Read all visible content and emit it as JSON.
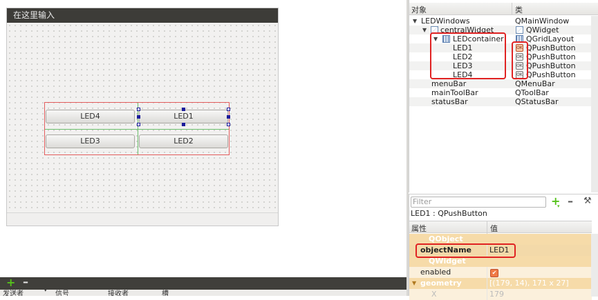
{
  "form": {
    "title_bar_text": "在这里输入",
    "buttons": {
      "led1": "LED1",
      "led2": "LED2",
      "led3": "LED3",
      "led4": "LED4"
    }
  },
  "signal_slot_panel": {
    "add_icon": "plus-icon",
    "remove_icon": "minus-icon",
    "columns": [
      "发送者",
      "信号",
      "接收者",
      "槽"
    ]
  },
  "object_inspector": {
    "headers": {
      "object": "对象",
      "class": "类"
    },
    "items": [
      {
        "name": "LEDWindows",
        "class": "QMainWindow",
        "icon": ""
      },
      {
        "name": "centralWidget",
        "class": "QWidget",
        "icon": "widget-icon"
      },
      {
        "name": "LEDcontainer",
        "class": "QGridLayout",
        "icon": "grid-layout-icon"
      },
      {
        "name": "LED1",
        "class": "QPushButton",
        "icon": "pushbutton-icon"
      },
      {
        "name": "LED2",
        "class": "QPushButton",
        "icon": "pushbutton-icon"
      },
      {
        "name": "LED3",
        "class": "QPushButton",
        "icon": "pushbutton-icon"
      },
      {
        "name": "LED4",
        "class": "QPushButton",
        "icon": "pushbutton-icon"
      },
      {
        "name": "menuBar",
        "class": "QMenuBar",
        "icon": ""
      },
      {
        "name": "mainToolBar",
        "class": "QToolBar",
        "icon": ""
      },
      {
        "name": "statusBar",
        "class": "QStatusBar",
        "icon": ""
      }
    ]
  },
  "property_editor": {
    "filter_placeholder": "Filter",
    "selected_object": "LED1 : QPushButton",
    "headers": {
      "property": "属性",
      "value": "值"
    },
    "groups": {
      "qobject": "QObject",
      "qwidget": "QWidget"
    },
    "properties": {
      "object_name": {
        "name": "objectName",
        "value": "LED1"
      },
      "enabled": {
        "name": "enabled",
        "value": true
      },
      "geometry": {
        "name": "geometry",
        "value": "[(179, 14), 171 x 27]"
      },
      "x": {
        "name": "X",
        "value": "179"
      }
    }
  },
  "colors": {
    "highlight_box": "#e02222",
    "group_row": "#f6dba9",
    "add_button": "#55c21b"
  }
}
